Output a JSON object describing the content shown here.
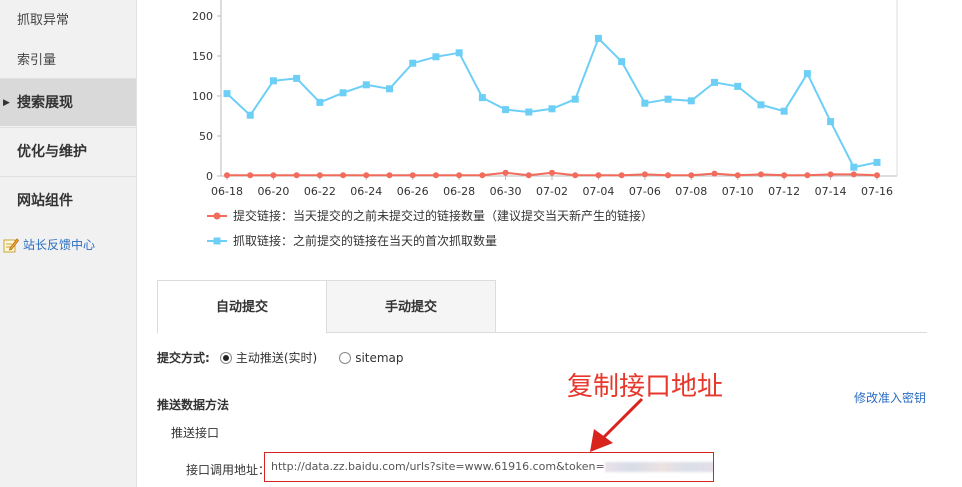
{
  "sidebar": {
    "sub_items": [
      {
        "label": "抓取异常"
      },
      {
        "label": "索引量"
      }
    ],
    "main_items": [
      {
        "label": "搜索展现",
        "active": true
      },
      {
        "label": "优化与维护",
        "active": false
      },
      {
        "label": "网站组件",
        "active": false
      }
    ],
    "feedback": {
      "label": "站长反馈中心",
      "icon": "pencil-note-icon"
    }
  },
  "chart_data": {
    "type": "line",
    "x": [
      "06-18",
      "06-19",
      "06-20",
      "06-21",
      "06-22",
      "06-23",
      "06-24",
      "06-25",
      "06-26",
      "06-27",
      "06-28",
      "06-29",
      "06-30",
      "07-01",
      "07-02",
      "07-03",
      "07-04",
      "07-05",
      "07-06",
      "07-07",
      "07-08",
      "07-09",
      "07-10",
      "07-11",
      "07-12",
      "07-13",
      "07-14",
      "07-15",
      "07-16"
    ],
    "x_tick_labels": [
      "06-18",
      "06-20",
      "06-22",
      "06-24",
      "06-26",
      "06-28",
      "06-30",
      "07-02",
      "07-04",
      "07-06",
      "07-08",
      "07-10",
      "07-12",
      "07-14",
      "07-16"
    ],
    "ylim": [
      0,
      220
    ],
    "y_ticks": [
      0,
      50,
      100,
      150,
      200
    ],
    "grid": false,
    "legend_placement": "bottom-left",
    "series": [
      {
        "name": "提交链接：当天提交的之前未提交过的链接数量（建议提交当天新产生的链接）",
        "color": "#f26b5b",
        "marker": "circle",
        "values": [
          1,
          1,
          1,
          1,
          1,
          1,
          1,
          1,
          1,
          1,
          1,
          1,
          4,
          1,
          4,
          1,
          1,
          1,
          2,
          1,
          1,
          3,
          1,
          2,
          1,
          1,
          2,
          2,
          1
        ]
      },
      {
        "name": "抓取链接：之前提交的链接在当天的首次抓取数量",
        "color": "#6dcff6",
        "marker": "square",
        "values": [
          103,
          76,
          119,
          122,
          92,
          104,
          114,
          109,
          141,
          149,
          154,
          98,
          83,
          80,
          84,
          96,
          172,
          143,
          91,
          96,
          94,
          117,
          112,
          89,
          81,
          128,
          68,
          11,
          17
        ]
      }
    ]
  },
  "tabs": [
    {
      "label": "自动提交",
      "active": true
    },
    {
      "label": "手动提交",
      "active": false
    }
  ],
  "submit_method": {
    "label": "提交方式:",
    "options": [
      {
        "label": "主动推送(实时)",
        "checked": true
      },
      {
        "label": "sitemap",
        "checked": false
      }
    ]
  },
  "push_section": {
    "title": "推送数据方法",
    "edit_key_link": "修改准入密钥",
    "api_label": "推送接口",
    "url_label": "接口调用地址：",
    "url_value": "http://data.zz.baidu.com/urls?site=www.61916.com&token="
  },
  "annotation": {
    "text": "复制接口地址",
    "color": "#e8372b"
  }
}
